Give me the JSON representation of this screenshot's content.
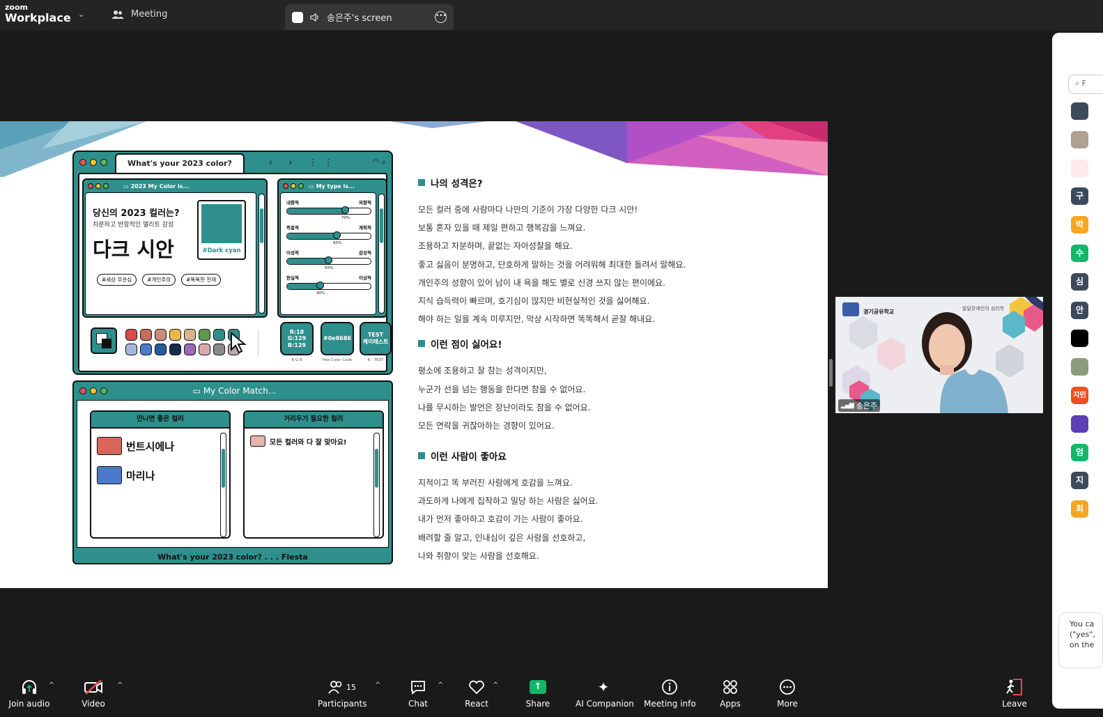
{
  "topbar": {
    "logo_small": "zoom",
    "logo_big": "Workplace",
    "meeting_label": "Meeting",
    "screen_tab_label": "송은주's screen"
  },
  "slide": {
    "mockup": {
      "tab_title": "What's your 2023 color?",
      "win1_title": "2023 My Color is...",
      "question": "당신의 2023 컬러는?",
      "subtitle": "차분하고 반항적인 엘리트 감성",
      "color_name": "다크 시안",
      "swatch_label": "#Dark cyan",
      "tags": [
        "#세상 무관심",
        "#개인주의",
        "#똑똑한 천재"
      ],
      "win2_title": "My type is...",
      "sliders": [
        {
          "left": "내향적",
          "right": "외향적",
          "value": 70,
          "pct_label": "70%"
        },
        {
          "left": "즉흥적",
          "right": "계획적",
          "value": 60,
          "pct_label": "60%"
        },
        {
          "left": "이성적",
          "right": "감성적",
          "value": 50,
          "pct_label": "50%"
        },
        {
          "left": "현실적",
          "right": "이상적",
          "value": 40,
          "pct_label": "40%"
        }
      ],
      "rgb_text": "R:18\nG:129\nB:129",
      "hex_text": "#0e8686",
      "test_text": "TEST\n케이테스트",
      "badge_labels": [
        "R G B",
        "Hex Color Code",
        "K - TEST"
      ],
      "palette_colors": [
        "#d94a4a",
        "#c96a5a",
        "#c98a7a",
        "#e8b84a",
        "#d9b48a",
        "#5a9a4a",
        "#2e8f8c",
        "#2e8f8c",
        "#a9b4d9",
        "#4a7ac9",
        "#2a5a9a",
        "#1a2a4a",
        "#9a6ab9",
        "#d9a9a9",
        "#8a8a8a",
        "#b9a9a9"
      ]
    },
    "match": {
      "title": "My Color Match...",
      "good_title": "만나면 좋은 컬러",
      "good_items": [
        {
          "name": "번트시에나",
          "color": "#d9655a"
        },
        {
          "name": "마리나",
          "color": "#4a7ac9"
        }
      ],
      "avoid_title": "거리두기 필요한 컬러",
      "avoid_item": "모든 컬러와 다 잘 맞아요!",
      "avoid_color": "#e8b4ac",
      "footer": "What's your 2023 color? . . . Fiesta"
    },
    "sections": [
      {
        "heading": "나의 성격은?",
        "lines": [
          "모든 컬러 중에 사람마다 나만의 기준이 가장 다양한 다크 시안!",
          "보통 혼자 있을 때 제일 편하고 행복감을 느껴요.",
          "조용하고 차분하며, 끝없는 자아성찰을 해요.",
          "좋고 싫음이 분명하고, 단호하게 말하는 것을 어려워해 최대한 돌려서 말해요.",
          "개인주의 성향이 있어 남이 내 욕을 해도 별로 신경 쓰지 않는 편이에요.",
          "지식 습득력이 빠르며, 호기심이 많지만 비현실적인 것을 싫어해요.",
          "해야 하는 일을 계속 미루지만, 막상 시작하면 똑똑해서 곧잘 해내요."
        ]
      },
      {
        "heading": "이런 점이 싫어요!",
        "lines": [
          "평소에 조용하고 잘 참는 성격이지만,",
          "누군가 선을 넘는 행동을 한다면 참을 수 없어요.",
          "나를 무시하는 발언은 장난이라도 참을 수 없어요.",
          "모든 연락을 귀찮아하는 경향이 있어요."
        ]
      },
      {
        "heading": "이런 사람이 좋아요",
        "lines": [
          "지적이고 똑 부러진 사람에게 호감을 느껴요.",
          "과도하게 나에게 집착하고 밀당 하는 사람은 싫어요.",
          "내가 먼저 좋아하고 호감이 가는 사람이 좋아요.",
          "배려할 줄 알고, 인내심이 깊은 사람을 선호하고,",
          "나와 취향이 맞는 사람을 선호해요."
        ]
      }
    ]
  },
  "video": {
    "name": "송은주",
    "school_label": "경기공유학교",
    "banner_text": "발달장애인의 심리학"
  },
  "right_panel": {
    "search_placeholder": "F",
    "avatars": [
      {
        "text": "",
        "color": "#3d4a5c"
      },
      {
        "text": "",
        "color": "#b0a090"
      },
      {
        "text": "",
        "color": "#fde8ec"
      },
      {
        "text": "구",
        "color": "#3d4a5c"
      },
      {
        "text": "박",
        "color": "#f5a623"
      },
      {
        "text": "수",
        "color": "#12b76a"
      },
      {
        "text": "심",
        "color": "#3d4a5c"
      },
      {
        "text": "안",
        "color": "#3d4a5c"
      },
      {
        "text": "",
        "color": "#000000"
      },
      {
        "text": "",
        "color": "#8a9a7a"
      },
      {
        "text": "지민",
        "color": "#f04e23"
      },
      {
        "text": "",
        "color": "#5b3fb5"
      },
      {
        "text": "엄",
        "color": "#12b76a"
      },
      {
        "text": "지",
        "color": "#3d4a5c"
      },
      {
        "text": "최",
        "color": "#f5a623"
      }
    ],
    "message": "You ca (\"yes\", on the"
  },
  "toolbar": {
    "join_audio": "Join audio",
    "video": "Video",
    "participants": "Participants",
    "participant_count": "15",
    "chat": "Chat",
    "react": "React",
    "share": "Share",
    "ai_companion": "AI Companion",
    "meeting_info": "Meeting info",
    "apps": "Apps",
    "more": "More",
    "leave": "Leave"
  }
}
